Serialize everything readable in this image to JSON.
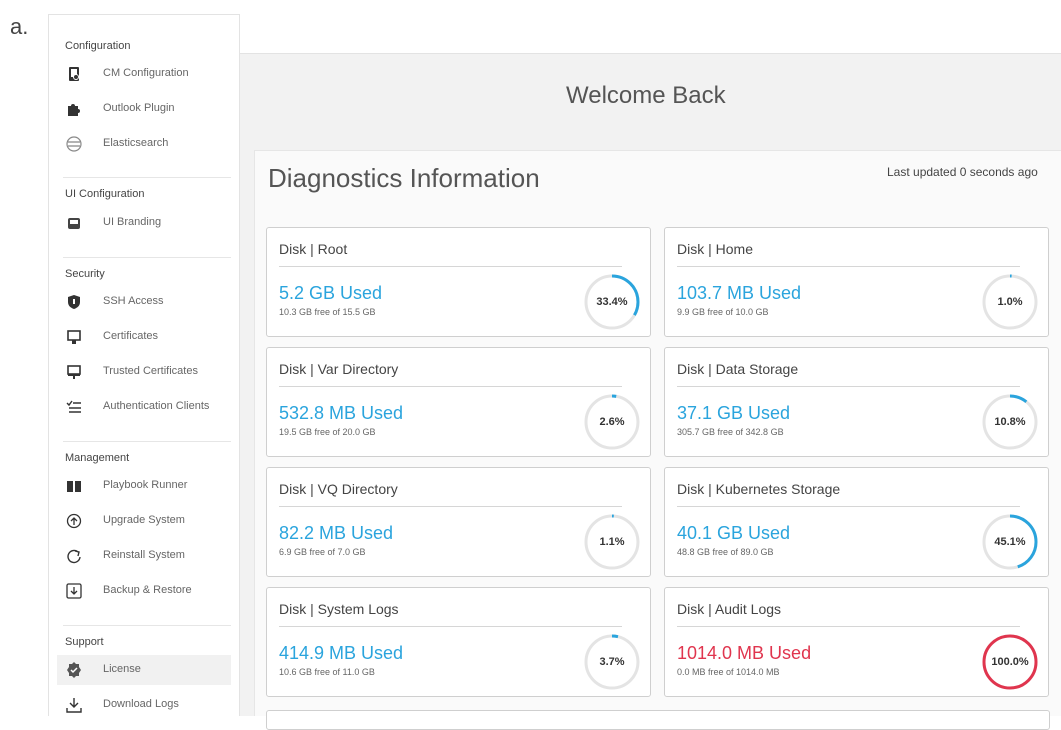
{
  "figure_label": "a.",
  "sidebar": {
    "sections": [
      {
        "title": "Configuration",
        "items": [
          {
            "label": "CM Configuration",
            "icon": "cm-config-icon"
          },
          {
            "label": "Outlook Plugin",
            "icon": "puzzle-icon"
          },
          {
            "label": "Elasticsearch",
            "icon": "elasticsearch-icon"
          }
        ]
      },
      {
        "title": "UI Configuration",
        "items": [
          {
            "label": "UI Branding",
            "icon": "branding-icon"
          }
        ]
      },
      {
        "title": "Security",
        "items": [
          {
            "label": "SSH Access",
            "icon": "shield-icon"
          },
          {
            "label": "Certificates",
            "icon": "certificate-icon"
          },
          {
            "label": "Trusted Certificates",
            "icon": "trusted-certificate-icon"
          },
          {
            "label": "Authentication Clients",
            "icon": "checklist-icon"
          }
        ]
      },
      {
        "title": "Management",
        "items": [
          {
            "label": "Playbook Runner",
            "icon": "book-icon"
          },
          {
            "label": "Upgrade System",
            "icon": "upgrade-icon"
          },
          {
            "label": "Reinstall System",
            "icon": "refresh-icon"
          },
          {
            "label": "Backup & Restore",
            "icon": "backup-icon"
          }
        ]
      },
      {
        "title": "Support",
        "items": [
          {
            "label": "License",
            "icon": "badge-check-icon",
            "active": true
          },
          {
            "label": "Download Logs",
            "icon": "download-icon"
          }
        ]
      }
    ]
  },
  "main": {
    "welcome": "Welcome Back",
    "diagnostics_title": "Diagnostics Information",
    "last_updated": "Last updated 0 seconds ago",
    "cards": [
      {
        "title": "Disk | Root",
        "used": "5.2 GB Used",
        "free": "10.3 GB free of 15.5 GB",
        "percent_label": "33.4%",
        "percent": 33.4,
        "critical": false
      },
      {
        "title": "Disk | Home",
        "used": "103.7 MB Used",
        "free": "9.9 GB free of 10.0 GB",
        "percent_label": "1.0%",
        "percent": 1.0,
        "critical": false
      },
      {
        "title": "Disk | Var Directory",
        "used": "532.8 MB Used",
        "free": "19.5 GB free of 20.0 GB",
        "percent_label": "2.6%",
        "percent": 2.6,
        "critical": false
      },
      {
        "title": "Disk | Data Storage",
        "used": "37.1 GB Used",
        "free": "305.7 GB free of 342.8 GB",
        "percent_label": "10.8%",
        "percent": 10.8,
        "critical": false
      },
      {
        "title": "Disk | VQ Directory",
        "used": "82.2 MB Used",
        "free": "6.9 GB free of 7.0 GB",
        "percent_label": "1.1%",
        "percent": 1.1,
        "critical": false
      },
      {
        "title": "Disk | Kubernetes Storage",
        "used": "40.1 GB Used",
        "free": "48.8 GB free of 89.0 GB",
        "percent_label": "45.1%",
        "percent": 45.1,
        "critical": false
      },
      {
        "title": "Disk | System Logs",
        "used": "414.9 MB Used",
        "free": "10.6 GB free of 11.0 GB",
        "percent_label": "3.7%",
        "percent": 3.7,
        "critical": false
      },
      {
        "title": "Disk | Audit Logs",
        "used": "1014.0 MB Used",
        "free": "0.0 MB free of 1014.0 MB",
        "percent_label": "100.0%",
        "percent": 100.0,
        "critical": true
      }
    ]
  },
  "colors": {
    "accent": "#2aa4dd",
    "critical": "#e0354e",
    "gauge_track": "#e4e4e4"
  }
}
